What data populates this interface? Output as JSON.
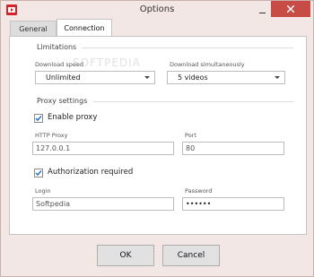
{
  "window": {
    "title": "Options"
  },
  "tabs": [
    {
      "label": "General"
    },
    {
      "label": "Connection"
    }
  ],
  "limitations": {
    "heading": "Limitations",
    "download_speed": {
      "label": "Download speed",
      "value": "Unlimited"
    },
    "download_simultaneously": {
      "label": "Download simultaneously",
      "value": "5 videos"
    }
  },
  "proxy": {
    "heading": "Proxy settings",
    "enable_label": "Enable proxy",
    "enabled": true,
    "http_proxy": {
      "label": "HTTP Proxy",
      "value": "127.0.0.1"
    },
    "port": {
      "label": "Port",
      "value": "80"
    },
    "auth_label": "Authorization required",
    "auth_required": true,
    "login": {
      "label": "Login",
      "value": "Softpedia"
    },
    "password": {
      "label": "Password",
      "value": "••••••"
    }
  },
  "buttons": {
    "ok": "OK",
    "cancel": "Cancel"
  },
  "watermark": "SOFTPEDIA",
  "colors": {
    "close_button": "#c74c45",
    "app_icon": "#d4242a",
    "check": "#2a73c5"
  }
}
